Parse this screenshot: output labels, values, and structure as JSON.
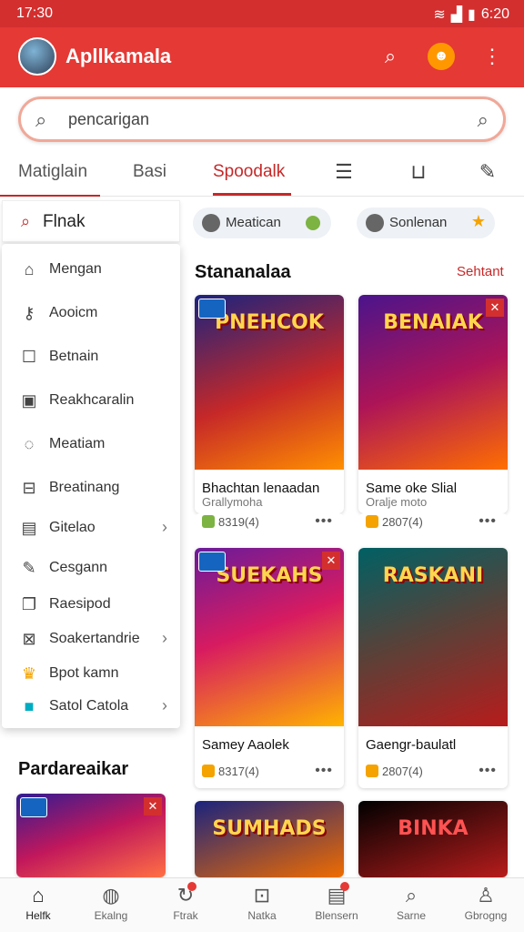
{
  "status": {
    "time": "17:30",
    "clock": "6:20"
  },
  "appbar": {
    "title": "Apllkamala",
    "search_icon": "search-icon",
    "avatar_icon": "user-icon",
    "more_icon": "more-vert-icon"
  },
  "search": {
    "placeholder": "pencarigan"
  },
  "tabs": [
    {
      "label": "Matiglain"
    },
    {
      "label": "Basi"
    },
    {
      "label": "Spoodalk"
    }
  ],
  "dropdown": {
    "label": "Flnak"
  },
  "menu": [
    {
      "label": "Mengan",
      "icon": "home-icon"
    },
    {
      "label": "Aooicm",
      "icon": "key-icon"
    },
    {
      "label": "Betnain",
      "icon": "square-icon"
    },
    {
      "label": "Reakhcaralin",
      "icon": "frame-icon"
    },
    {
      "label": "Meatiam",
      "icon": "chat-icon"
    },
    {
      "label": "Breatinang",
      "icon": "minus-box-icon"
    },
    {
      "label": "Gitelao",
      "icon": "calendar-icon",
      "chevron": true
    },
    {
      "label": "Cesgann",
      "icon": "pen-icon"
    },
    {
      "label": "Raesipod",
      "icon": "copy-icon"
    },
    {
      "label": "Soakertandrie",
      "icon": "cross-box-icon",
      "chevron": true
    },
    {
      "label": "Bpot kamn",
      "icon": "trophy-icon"
    },
    {
      "label": "Satol Catola",
      "icon": "app-icon",
      "chevron": true
    }
  ],
  "chips": [
    {
      "label": "Meatican"
    },
    {
      "label": "Sonlenan"
    }
  ],
  "section1": {
    "title": "Stananalaa",
    "link": "Sehtant"
  },
  "section2": {
    "title": "Pardareaikar"
  },
  "cards": [
    {
      "art_title": "PNEHCOK",
      "title": "Bhachtan lenaadan",
      "sub": "Grallymoha",
      "rating": "8319(4)"
    },
    {
      "art_title": "BENAIAK",
      "title": "Same oke Slial",
      "sub": "Oralje moto",
      "rating": "2807(4)"
    },
    {
      "art_title": "SUEKAHS",
      "title": "Samey Aaolek",
      "sub": "",
      "rating": "8317(4)"
    },
    {
      "art_title": "RASKANI",
      "title": "Gaengr-baulatl",
      "sub": "",
      "rating": "2807(4)"
    },
    {
      "art_title": "",
      "title": "",
      "sub": "",
      "rating": ""
    },
    {
      "art_title": "SUMHADS",
      "title": "",
      "sub": "",
      "rating": ""
    },
    {
      "art_title": "BINKA",
      "title": "",
      "sub": "",
      "rating": ""
    }
  ],
  "bottomnav": [
    {
      "label": "Helfk",
      "icon": "home-icon"
    },
    {
      "label": "Ekalng",
      "icon": "globe-icon"
    },
    {
      "label": "Ftrak",
      "icon": "refresh-icon"
    },
    {
      "label": "Natka",
      "icon": "box-icon"
    },
    {
      "label": "Blensern",
      "icon": "list-icon"
    },
    {
      "label": "Sarne",
      "icon": "search-icon"
    },
    {
      "label": "Gbrogng",
      "icon": "person-icon"
    }
  ],
  "colors": {
    "primary": "#e53935",
    "status": "#d32f2f",
    "accent": "#c62828"
  }
}
